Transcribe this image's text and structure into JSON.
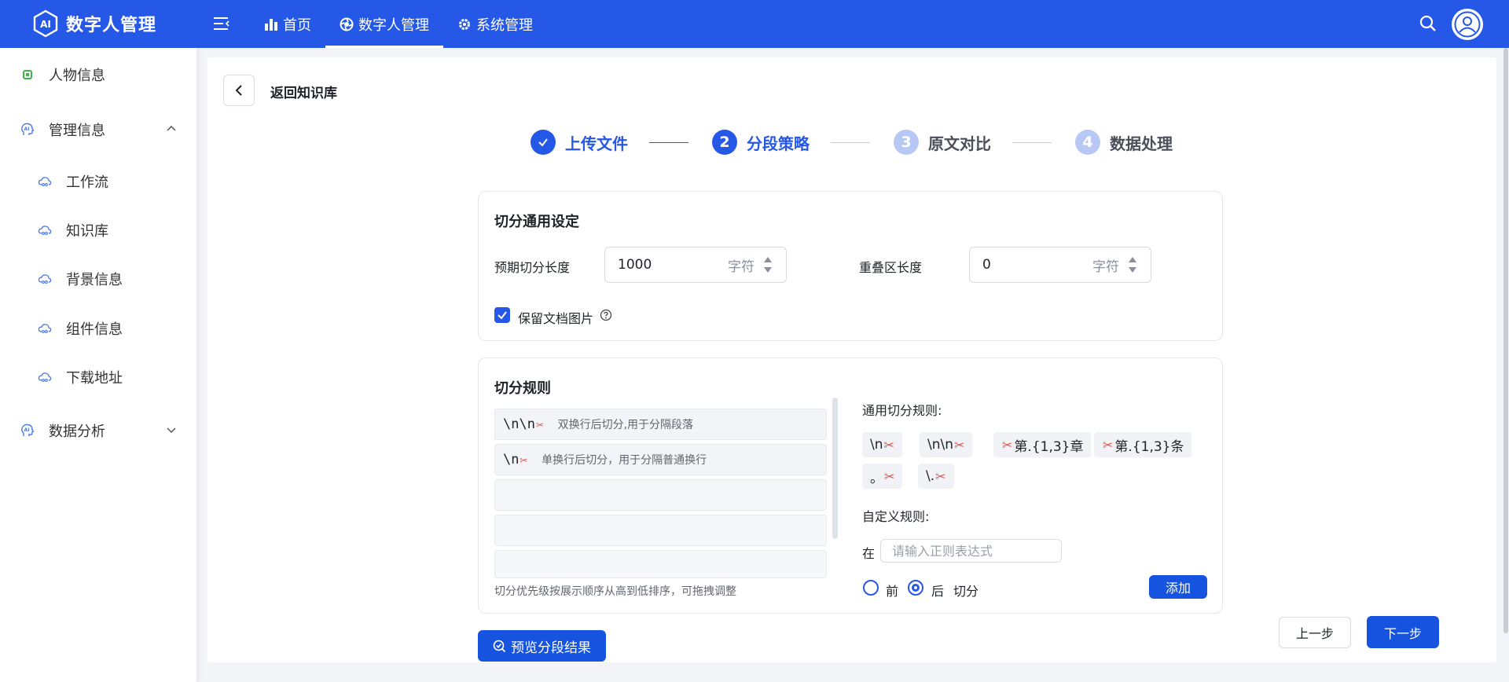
{
  "app": {
    "title": "数字人管理"
  },
  "topnav": [
    {
      "label": "首页",
      "icon": "bar-chart-icon"
    },
    {
      "label": "数字人管理",
      "icon": "aperture-icon",
      "active": true
    },
    {
      "label": "系统管理",
      "icon": "gear-icon"
    }
  ],
  "sidebar": {
    "items": [
      {
        "label": "人物信息",
        "icon": "chip-icon"
      },
      {
        "label": "管理信息",
        "icon": "ai-head-icon",
        "expanded": true
      },
      {
        "label": "工作流",
        "icon": "cloud-link-icon"
      },
      {
        "label": "知识库",
        "icon": "cloud-link-icon"
      },
      {
        "label": "背景信息",
        "icon": "cloud-link-icon"
      },
      {
        "label": "组件信息",
        "icon": "cloud-link-icon"
      },
      {
        "label": "下载地址",
        "icon": "cloud-link-icon"
      },
      {
        "label": "数据分析",
        "icon": "ai-head-icon",
        "expanded": false
      }
    ]
  },
  "page": {
    "back_label": "返回知识库"
  },
  "steps": [
    {
      "num": "1",
      "label": "上传文件",
      "status": "done"
    },
    {
      "num": "2",
      "label": "分段策略",
      "status": "current"
    },
    {
      "num": "3",
      "label": "原文对比",
      "status": "todo"
    },
    {
      "num": "4",
      "label": "数据处理",
      "status": "todo"
    }
  ],
  "general": {
    "title": "切分通用设定",
    "chunk_length_label": "预期切分长度",
    "chunk_length_value": "1000",
    "overlap_label": "重叠区长度",
    "overlap_value": "0",
    "unit": "字符",
    "keep_images_label": "保留文档图片",
    "keep_images_checked": true
  },
  "rules": {
    "title": "切分规则",
    "list": [
      {
        "pattern": "\\n\\n",
        "desc": "双换行后切分,用于分隔段落"
      },
      {
        "pattern": "\\n",
        "desc": "单换行后切分，用于分隔普通换行"
      }
    ],
    "hint": "切分优先级按展示顺序从高到低排序，可拖拽调整",
    "common_label": "通用切分规则:",
    "common_tags": [
      {
        "text": "\\n",
        "scissors": "after"
      },
      {
        "text": "\\n\\n",
        "scissors": "after"
      },
      {
        "text": "第.{1,3}章",
        "scissors": "before"
      },
      {
        "text": "第.{1,3}条",
        "scissors": "before"
      },
      {
        "text": "。",
        "scissors": "after"
      },
      {
        "text": "\\.",
        "scissors": "after"
      }
    ],
    "custom_label": "自定义规则:",
    "at_label": "在",
    "regex_placeholder": "请输入正则表达式",
    "before_label": "前",
    "after_label": "后",
    "split_label": "切分",
    "position_selected": "后",
    "add_label": "添加"
  },
  "actions": {
    "preview_label": "预览分段结果",
    "prev_label": "上一步",
    "next_label": "下一步"
  },
  "colors": {
    "primary": "#2658e8",
    "scissors": "#d9534f"
  }
}
